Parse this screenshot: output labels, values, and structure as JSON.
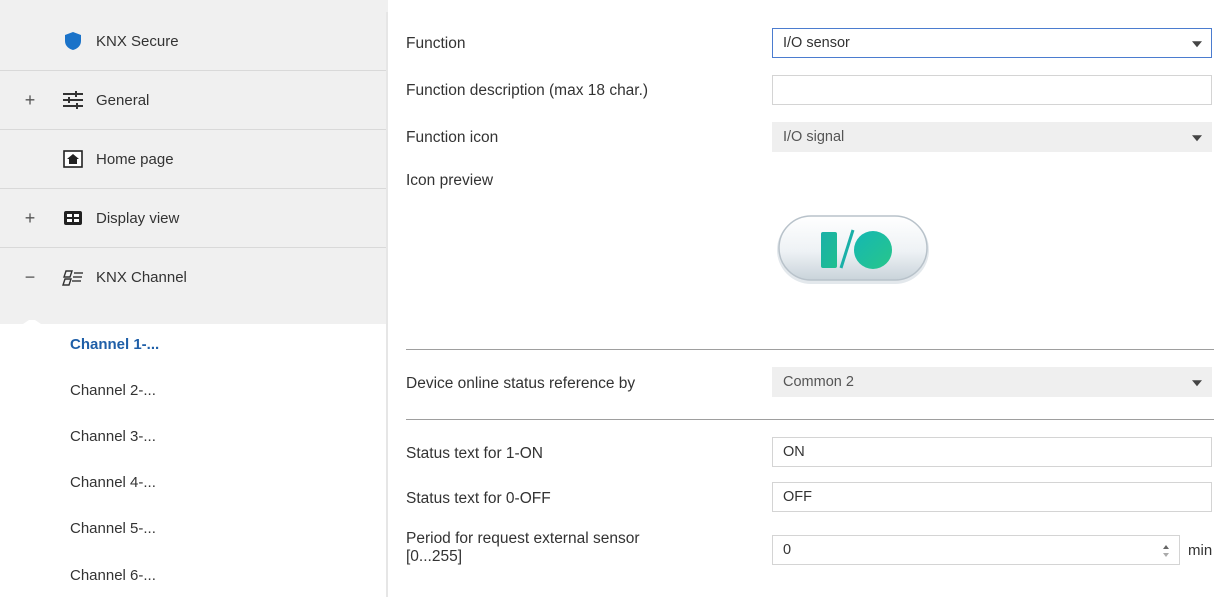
{
  "sidebar": {
    "items": [
      {
        "label": "KNX Secure",
        "icon": "shield-icon",
        "expander": ""
      },
      {
        "label": "General",
        "icon": "sliders-icon",
        "expander": "+"
      },
      {
        "label": "Home page",
        "icon": "home-icon",
        "expander": ""
      },
      {
        "label": "Display view",
        "icon": "display-grid-icon",
        "expander": "+"
      },
      {
        "label": "KNX Channel",
        "icon": "channel-icon",
        "expander": "−"
      }
    ],
    "channels": [
      "Channel 1-...",
      "Channel 2-...",
      "Channel 3-...",
      "Channel 4-...",
      "Channel 5-...",
      "Channel 6-..."
    ],
    "selected_channel": "Channel 1-..."
  },
  "colors": {
    "accent": "#1f5fa8",
    "shield": "#1b73c9",
    "icon_preview_bar": "#19b3a2"
  },
  "form": {
    "function_label": "Function",
    "function_value": "I/O sensor",
    "description_label": "Function description (max 18 char.)",
    "description_value": "",
    "icon_label": "Function icon",
    "icon_value": "I/O signal",
    "preview_label": "Icon preview",
    "preview_glyph": "I/O",
    "online_label": "Device online status reference by",
    "online_value": "Common 2",
    "on_label": "Status text for 1-ON",
    "on_value": "ON",
    "off_label": "Status text for 0-OFF",
    "off_value": "OFF",
    "period_label_line1": "Period for request external sensor",
    "period_label_line2": "[0...255]",
    "period_value": "0",
    "period_unit": "min"
  }
}
